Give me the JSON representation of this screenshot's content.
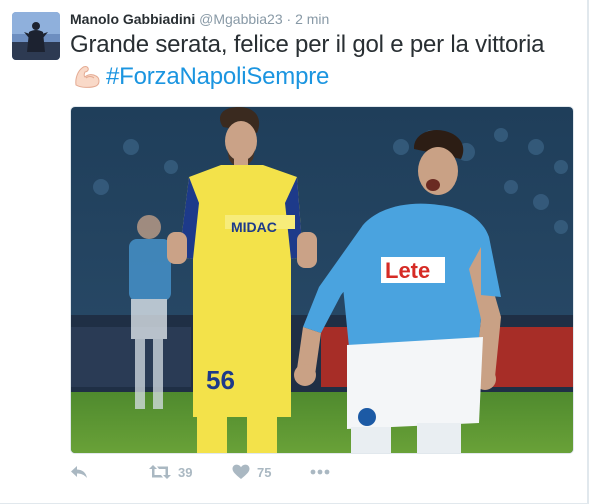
{
  "user": {
    "fullname": "Manolo Gabbiadini",
    "handle": "@Mgabbia23",
    "separator": "·",
    "time": "2 min"
  },
  "tweet": {
    "text_before": "Grande serata, felice per il gol e per la vittoria",
    "emoji": "flexed-biceps-icon",
    "hashtag": "#ForzaNapoliSempre",
    "hashtag_color": "#1b95e0"
  },
  "media": {
    "shirt_sponsor_napoli": "Lete",
    "shirt_sponsor_chievo": "MIDAC",
    "shirt_number_chievo": "56",
    "kit_colors": {
      "napoli": "#4aa3df",
      "chievo": "#f3e24a"
    }
  },
  "actions": {
    "reply": {
      "icon": "reply-icon"
    },
    "retweet": {
      "icon": "retweet-icon",
      "count": "39"
    },
    "like": {
      "icon": "heart-icon",
      "count": "75"
    },
    "more": {
      "icon": "more-dots-icon"
    }
  }
}
